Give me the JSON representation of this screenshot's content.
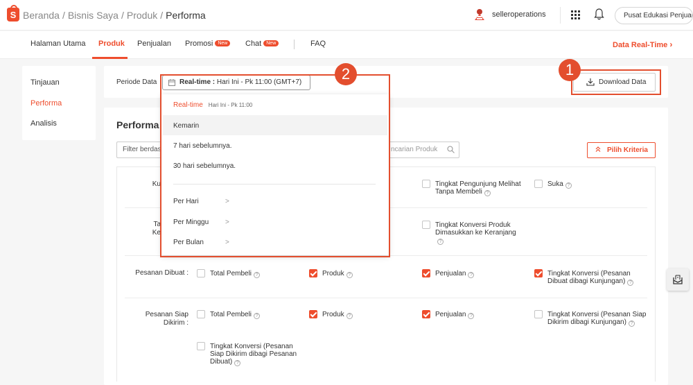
{
  "breadcrumb": {
    "items": [
      "Beranda",
      "Bisnis Saya",
      "Produk"
    ],
    "current": "Performa",
    "separator": "/"
  },
  "logo_letter": "S",
  "header": {
    "username": "selleroperations",
    "edu_button": "Pusat Edukasi Penjual",
    "grid_icon": "grid-icon",
    "bell_icon": "bell-icon"
  },
  "nav": {
    "tabs": [
      {
        "label": "Halaman Utama"
      },
      {
        "label": "Produk",
        "active": true
      },
      {
        "label": "Penjualan"
      },
      {
        "label": "Promosi",
        "badge": "New"
      },
      {
        "label": "Chat",
        "badge": "New"
      },
      {
        "label": "FAQ"
      }
    ],
    "realtime_link": "Data Real-Time"
  },
  "sidebar": {
    "items": [
      {
        "label": "Tinjauan"
      },
      {
        "label": "Performa",
        "active": true
      },
      {
        "label": "Analisis"
      }
    ]
  },
  "period": {
    "label": "Periode Data",
    "selected_type": "Real-time :",
    "selected_range": "Hari Ini - Pk 11:00 (GMT+7)"
  },
  "download_button": "Download Data",
  "annotations": [
    "1",
    "2"
  ],
  "main": {
    "title": "Performa P",
    "filter_label": "Filter berdas",
    "search_placeholder": "ncarian Produk",
    "criteria_button": "Pilih Kriteria"
  },
  "dropdown": {
    "items": [
      {
        "label": "Real-time",
        "sub": "Hari Ini - Pk 11:00",
        "selected": true
      },
      {
        "label": "Kemarin"
      },
      {
        "label": "7 hari sebelumnya."
      },
      {
        "label": "30 hari sebelumnya."
      },
      {
        "label": "Per Hari",
        "arrow": ">"
      },
      {
        "label": "Per Minggu",
        "arrow": ">"
      },
      {
        "label": "Per Bulan",
        "arrow": ">"
      }
    ]
  },
  "criteria": {
    "rows": [
      {
        "label": "Ku",
        "items": [
          {
            "label": "Tingkat Pengunjung Melihat Tanpa Membeli",
            "checked": false
          },
          {
            "label": "Suka",
            "checked": false
          }
        ]
      },
      {
        "label": "Ta Ke",
        "items": [
          {
            "label": "Tingkat Konversi Produk Dimasukkan ke Keranjang",
            "checked": false
          }
        ]
      },
      {
        "label": "Pesanan Dibuat :",
        "items": [
          {
            "label": "Total Pembeli",
            "checked": false
          },
          {
            "label": "Produk",
            "checked": true
          },
          {
            "label": "Penjualan",
            "checked": true
          },
          {
            "label": "Tingkat Konversi (Pesanan Dibuat dibagi Kunjungan)",
            "checked": true
          }
        ]
      },
      {
        "label": "Pesanan Siap Dikirim :",
        "items": [
          {
            "label": "Total Pembeli",
            "checked": false
          },
          {
            "label": "Produk",
            "checked": true
          },
          {
            "label": "Penjualan",
            "checked": true
          },
          {
            "label": "Tingkat Konversi (Pesanan Siap Dikirim dibagi Kunjungan)",
            "checked": false
          },
          {
            "label": "Tingkat Konversi (Pesanan Siap Dikirim dibagi Pesanan Dibuat)",
            "checked": false
          }
        ]
      }
    ],
    "help_glyph": "?"
  },
  "colors": {
    "brand": "#ee4d2d",
    "highlight": "#e34e2e"
  }
}
